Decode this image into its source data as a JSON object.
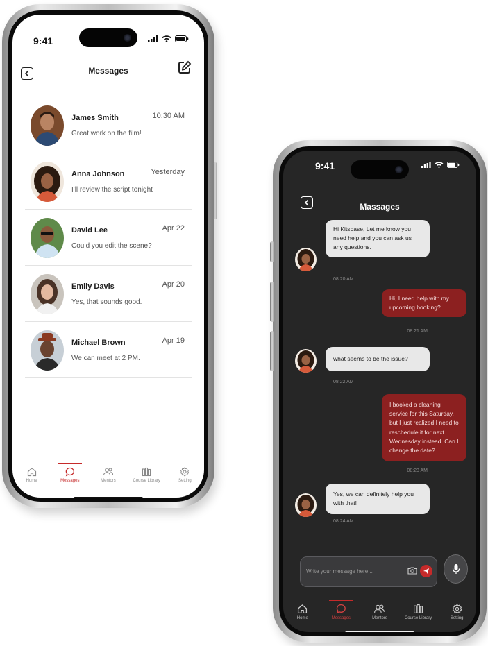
{
  "colors": {
    "accent": "#c62a2a",
    "dark_bg": "#262626",
    "bubble_out": "#8c2020",
    "bubble_in": "#e8e8e8"
  },
  "light_phone": {
    "status_time": "9:41",
    "title": "Messages",
    "icons": {
      "back": "chevron-left-icon",
      "compose": "compose-icon"
    },
    "conversations": [
      {
        "name": "James Smith",
        "preview": "Great work on the film!",
        "time": "10:30 AM"
      },
      {
        "name": "Anna Johnson",
        "preview": "I'll review the script tonight",
        "time": "Yesterday"
      },
      {
        "name": "David Lee",
        "preview": "Could you edit the scene?",
        "time": "Apr 22"
      },
      {
        "name": "Emily Davis",
        "preview": "Yes, that sounds good.",
        "time": "Apr 20"
      },
      {
        "name": "Michael Brown",
        "preview": "We can meet at 2 PM.",
        "time": "Apr 19"
      }
    ],
    "tabs": [
      {
        "label": "Home",
        "icon": "home-icon",
        "active": false
      },
      {
        "label": "Messages",
        "icon": "chat-icon",
        "active": true
      },
      {
        "label": "Mentors",
        "icon": "people-icon",
        "active": false
      },
      {
        "label": "Course Library",
        "icon": "library-icon",
        "active": false
      },
      {
        "label": "Setting",
        "icon": "gear-icon",
        "active": false
      }
    ]
  },
  "dark_phone": {
    "status_time": "9:41",
    "title": "Massages",
    "messages": [
      {
        "direction": "in",
        "text": "Hi Kitsbase, Let me know you need help and you can ask us any questions.",
        "time": "08:20 AM"
      },
      {
        "direction": "out",
        "text": "Hi, I need help with my upcoming booking?",
        "time": "08:21 AM"
      },
      {
        "direction": "in",
        "text": "what seems to be the issue?",
        "time": "08:22 AM"
      },
      {
        "direction": "out",
        "text": "I booked a cleaning service for this Saturday, but I just realized I need to reschedule it for next Wednesday instead. Can I change the date?",
        "time": "08:23 AM"
      },
      {
        "direction": "in",
        "text": "Yes, we can definitely help you with that!",
        "time": "08:24 AM"
      }
    ],
    "composer": {
      "placeholder": "Write your message here...",
      "icons": [
        "camera-icon",
        "send-icon",
        "microphone-icon"
      ]
    },
    "tabs": [
      {
        "label": "Home",
        "icon": "home-icon",
        "active": false
      },
      {
        "label": "Messages",
        "icon": "chat-icon",
        "active": true
      },
      {
        "label": "Mentors",
        "icon": "people-icon",
        "active": false
      },
      {
        "label": "Course Library",
        "icon": "library-icon",
        "active": false
      },
      {
        "label": "Setting",
        "icon": "gear-icon",
        "active": false
      }
    ]
  }
}
